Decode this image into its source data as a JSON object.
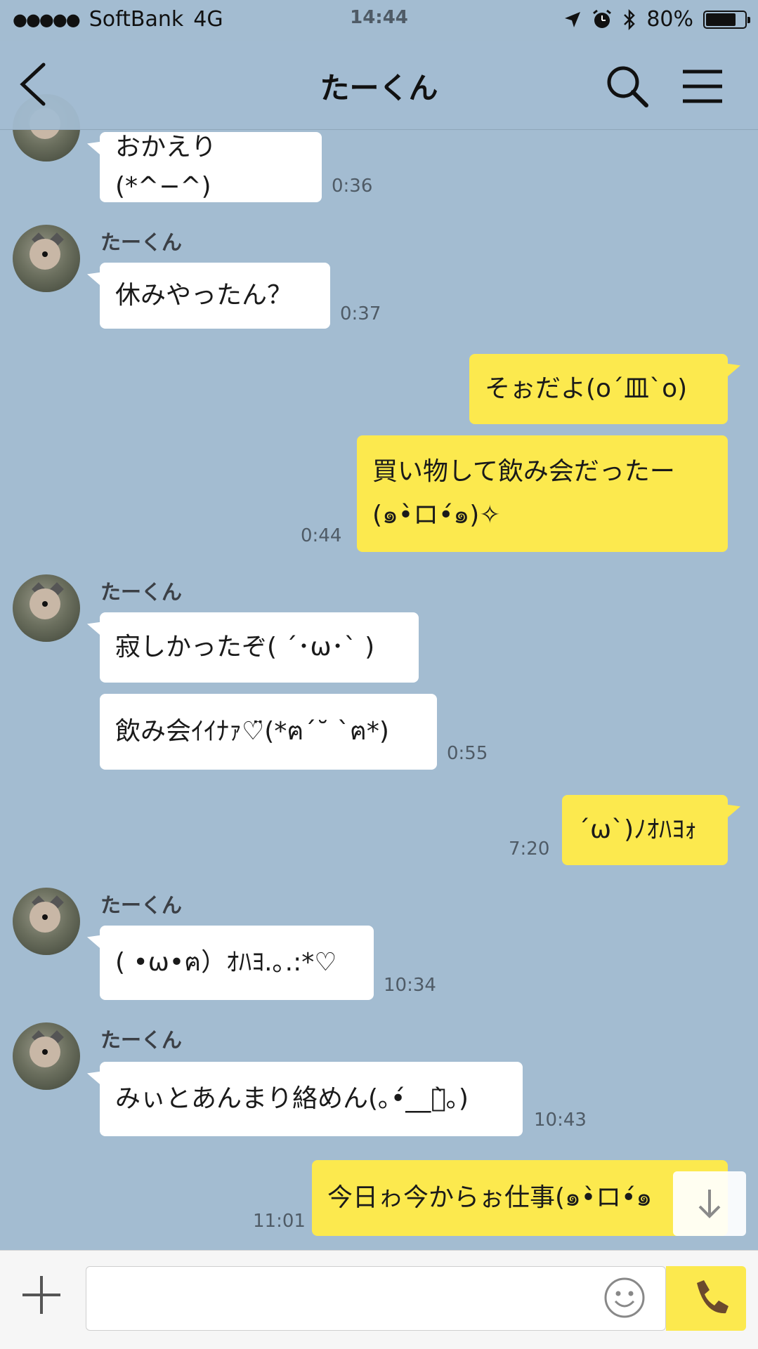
{
  "status_bar": {
    "signal_dots": "●●●●●",
    "carrier": "SoftBank",
    "network": "4G",
    "time": "14:44",
    "battery": "80%",
    "battery_level": 0.8
  },
  "header": {
    "title": "たーくん"
  },
  "messages": [
    {
      "side": "left",
      "text": "おかえり(*^−^)",
      "time": "0:36"
    },
    {
      "side": "left",
      "sender": "たーくん",
      "text": "休みやったん？",
      "time": "0:37"
    },
    {
      "side": "right",
      "text": "そぉだよ(o´皿`o)"
    },
    {
      "side": "right",
      "text_line1": "買い物して飲み会だったー",
      "text_line2": "(๑•̀ロ•́๑)✧",
      "time": "0:44"
    },
    {
      "side": "left",
      "sender": "たーくん",
      "text": "寂しかったぞ( ´･ω･` )"
    },
    {
      "side": "left",
      "text": "飲み会ｲｲﾅｧ♡̈(*ฅ´˘ `ฅ*)",
      "time": "0:55"
    },
    {
      "side": "right",
      "text": "´ω`)ﾉｵﾊﾖｫ",
      "time": "7:20"
    },
    {
      "side": "left",
      "sender": "たーくん",
      "text": "( •ω•ฅ）ｵﾊﾖ.｡.:*♡",
      "time": "10:34"
    },
    {
      "side": "left",
      "sender": "たーくん",
      "text": "みぃとあんまり絡めん(｡•́__ก̀｡)",
      "time": "10:43"
    },
    {
      "side": "right",
      "text": "今日ゎ今からぉ仕事(๑•̀ロ•́๑",
      "time": "11:01"
    }
  ],
  "input": {
    "placeholder": ""
  },
  "icons": {
    "back": "chevron-left-icon",
    "search": "search-icon",
    "menu": "hamburger-menu-icon",
    "plus": "plus-icon",
    "emoji": "smiley-icon",
    "call": "phone-icon",
    "scroll_down": "arrow-down-icon"
  },
  "colors": {
    "background": "#a3bcd1",
    "own_bubble": "#fce94e",
    "other_bubble": "#ffffff"
  }
}
